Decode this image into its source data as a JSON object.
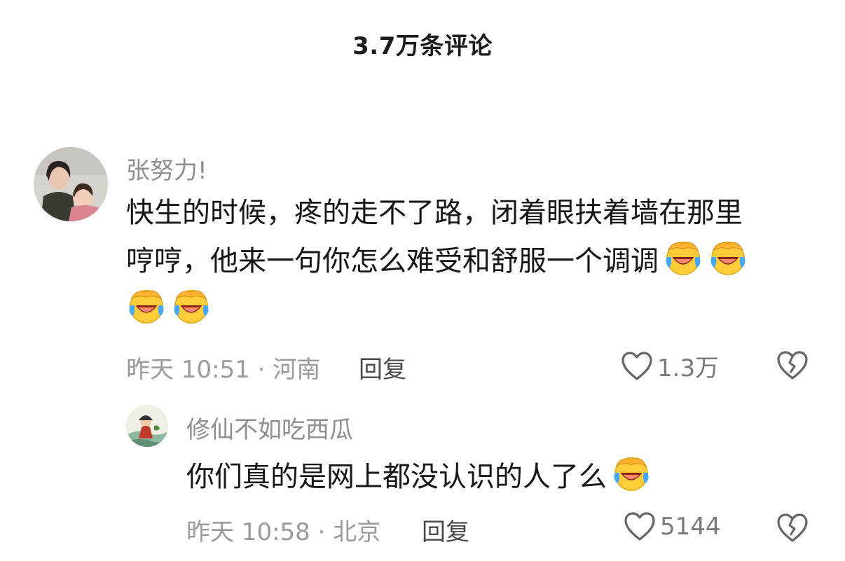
{
  "header": {
    "title": "3.7万条评论"
  },
  "comments": [
    {
      "username": "张努力!",
      "lines": [
        "快生的时候，疼的走不了路，闭着眼扶着墙在那里",
        "哼哼，他来一句你怎么难受和舒服一个调调"
      ],
      "emoji": "face-with-tears-of-joy",
      "meta": "昨天 10:51 · 河南",
      "reply_label": "回复",
      "likes": "1.3万"
    },
    {
      "username": "修仙不如吃西瓜",
      "text": "你们真的是网上都没认识的人了么",
      "emoji": "face-with-tears-of-joy",
      "meta": "昨天 10:58 · 北京",
      "reply_label": "回复",
      "likes": "5144"
    }
  ],
  "colors": {
    "username": "#8f8f8f",
    "body": "#161616",
    "meta": "#9a9a9a",
    "accent": "#4a4a4a"
  }
}
